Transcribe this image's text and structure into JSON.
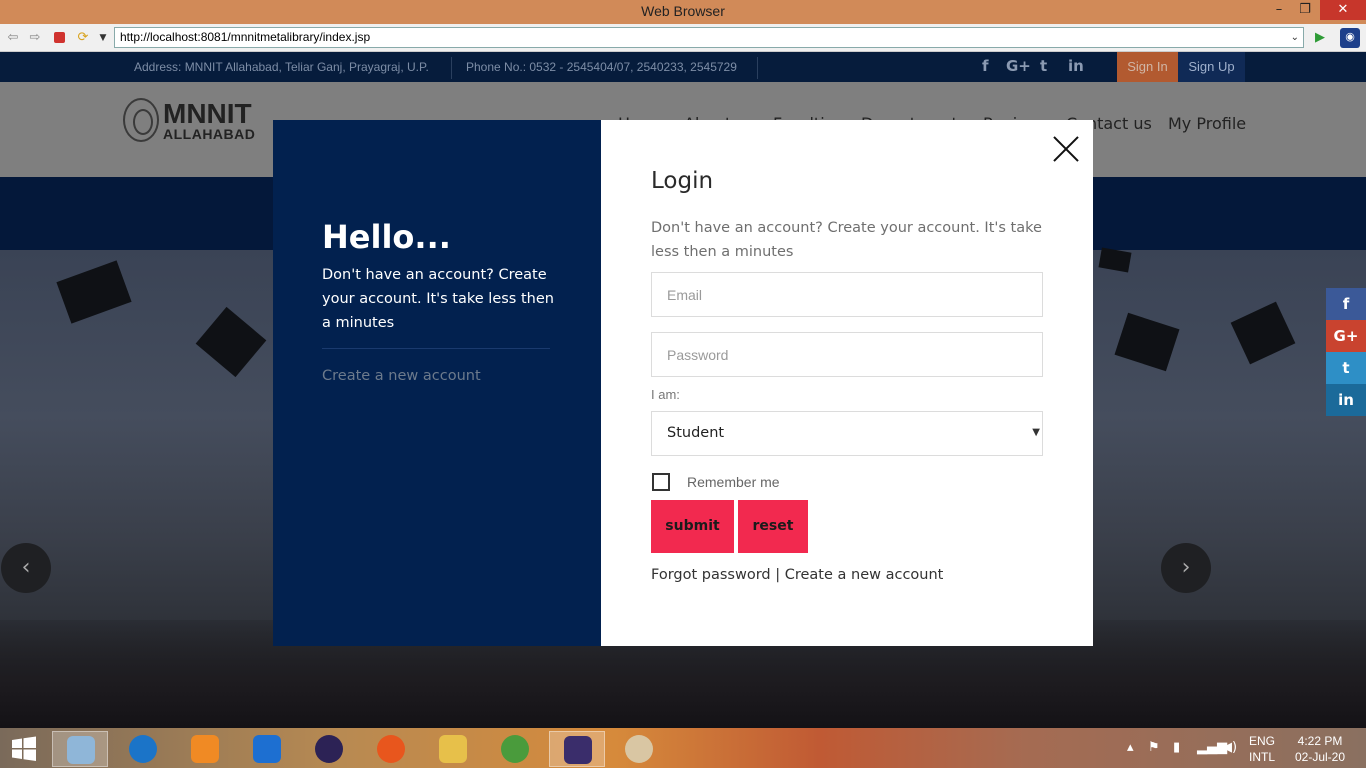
{
  "window": {
    "title": "Web Browser",
    "min": "–",
    "max": "❐",
    "close": "✕"
  },
  "browser": {
    "url": "http://localhost:8081/mnnitmetalibrary/index.jsp"
  },
  "topbar": {
    "address": "Address: MNNIT Allahabad, Teliar Ganj, Prayagraj, U.P.",
    "phone": "Phone No.: 0532 - 2545404/07, 2540233, 2545729",
    "social": [
      "f",
      "G+",
      "t",
      "in"
    ],
    "signin": "Sign In",
    "signup": "Sign Up"
  },
  "header": {
    "logo_line1": "MNNIT",
    "logo_line2": "ALLAHABAD",
    "nav": [
      "Home",
      "About us",
      "Faculties",
      "Departments",
      "Reviews",
      "Contact us",
      "My Profile"
    ]
  },
  "side_social": [
    "f",
    "G+",
    "t",
    "in"
  ],
  "slider": {
    "prev": "‹",
    "next": "›"
  },
  "modal": {
    "left": {
      "title": "Hello...",
      "desc": "Don't have an account? Create your account. It's take less then a minutes",
      "create_link": "Create a new account"
    },
    "right": {
      "title": "Login",
      "desc": "Don't have an account? Create your account. It's take less then a minutes",
      "email_placeholder": "Email",
      "password_placeholder": "Password",
      "role_label": "I am:",
      "role_value": "Student",
      "remember": "Remember me",
      "submit": "submit",
      "reset": "reset",
      "forgot": "Forgot password",
      "separator": "|",
      "create": "Create a new account"
    }
  },
  "tray": {
    "lang1": "ENG",
    "lang2": "INTL",
    "time": "4:22 PM",
    "date": "02-Jul-20"
  },
  "colors": {
    "accent": "#f2294f",
    "navy": "#02214f",
    "info_bar": "#061c3c",
    "facebook": "#3b5998",
    "googleplus": "#c9432f",
    "twitter": "#2e8fc6",
    "linkedin": "#1b6a9a"
  }
}
